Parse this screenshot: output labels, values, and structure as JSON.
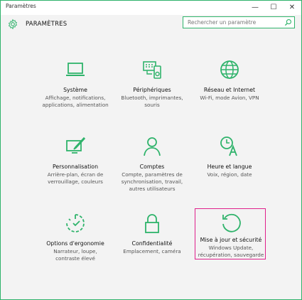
{
  "window": {
    "title": "Paramètres",
    "minimize_glyph": "—",
    "maximize_glyph": "☐",
    "close_glyph": "✕"
  },
  "header": {
    "title": "PARAMÈTRES",
    "icon": "gear-icon"
  },
  "search": {
    "placeholder": "Rechercher un paramètre",
    "icon": "search-icon"
  },
  "accent_color": "#2fb36b",
  "selection_color": "#e0208c",
  "tiles": [
    {
      "title": "Système",
      "desc": [
        "Affichage, notifications,",
        "applications, alimentation"
      ],
      "icon": "laptop-icon"
    },
    {
      "title": "Périphériques",
      "desc": [
        "Bluetooth, imprimantes,",
        "souris"
      ],
      "icon": "devices-icon"
    },
    {
      "title": "Réseau et Internet",
      "desc": [
        "Wi-Fi, mode Avion, VPN"
      ],
      "icon": "globe-icon"
    },
    {
      "title": "Personnalisation",
      "desc": [
        "Arrière-plan, écran de",
        "verrouillage, couleurs"
      ],
      "icon": "paint-icon"
    },
    {
      "title": "Comptes",
      "desc": [
        "Compte, paramètres de",
        "synchronisation, travail,",
        "autres utilisateurs"
      ],
      "icon": "person-icon"
    },
    {
      "title": "Heure et langue",
      "desc": [
        "Voix, région, date"
      ],
      "icon": "time-language-icon"
    },
    {
      "title": "Options d'ergonomie",
      "desc": [
        "Narrateur, loupe,",
        "contraste élevé"
      ],
      "icon": "ease-of-access-icon"
    },
    {
      "title": "Confidentialité",
      "desc": [
        "Emplacement, caméra"
      ],
      "icon": "lock-icon"
    },
    {
      "title": "Mise à jour et sécurité",
      "desc": [
        "Windows Update,",
        "récupération, sauvegarde"
      ],
      "icon": "update-icon",
      "selected": true
    }
  ]
}
